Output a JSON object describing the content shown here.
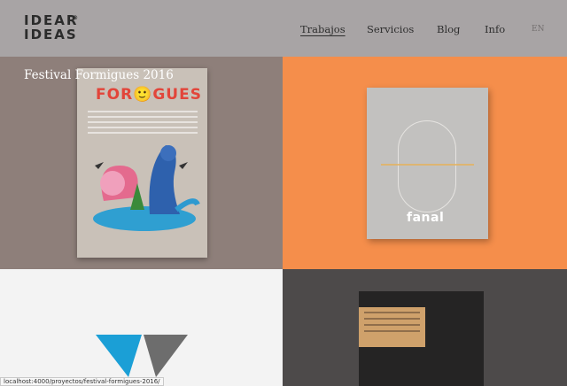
{
  "header": {
    "logo_line1": "IDEAR",
    "logo_line2": "IDEAS",
    "logo_mark": "®",
    "nav": [
      {
        "label": "Trabajos",
        "active": true
      },
      {
        "label": "Servicios"
      },
      {
        "label": "Blog"
      },
      {
        "label": "Info"
      }
    ],
    "lang": "EN"
  },
  "projects": [
    {
      "caption": "Festival Formigues 2016",
      "poster_title": "FOR🙂GUES",
      "bg": "#8e7f7a"
    },
    {
      "brand": "fanal",
      "bg": "#f58e4b"
    },
    {
      "bg": "#f3f3f3"
    },
    {
      "bg": "#4d4a4a"
    }
  ],
  "status_url": "localhost:4000/proyectos/festival-formigues-2016/",
  "colors": {
    "header_bg": "#a8a4a5",
    "accent_orange": "#f58e4b",
    "logo_blue": "#1b9fd6",
    "logo_grey": "#6d6d6d"
  }
}
